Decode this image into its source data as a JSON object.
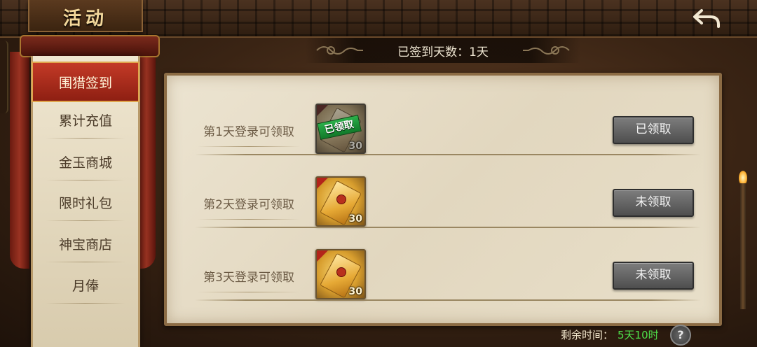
{
  "header": {
    "title": "活动",
    "back_icon": "back-arrow-icon"
  },
  "signed_banner": {
    "text": "已签到天数：1天"
  },
  "sidebar": {
    "items": [
      {
        "label": "围猎签到",
        "active": true
      },
      {
        "label": "累计充值",
        "active": false
      },
      {
        "label": "金玉商城",
        "active": false
      },
      {
        "label": "限时礼包",
        "active": false
      },
      {
        "label": "神宝商店",
        "active": false
      },
      {
        "label": "月俸",
        "active": false
      }
    ]
  },
  "rewards": [
    {
      "label": "第1天登录可领取",
      "item_count": "30",
      "stamp": "已领取",
      "button": "已领取",
      "claimed": true
    },
    {
      "label": "第2天登录可领取",
      "item_count": "30",
      "stamp": "",
      "button": "未领取",
      "claimed": false
    },
    {
      "label": "第3天登录可领取",
      "item_count": "30",
      "stamp": "",
      "button": "未领取",
      "claimed": false
    }
  ],
  "footer": {
    "remaining_label": "剩余时间：",
    "remaining_value": "5天10时",
    "help": "?"
  },
  "colors": {
    "active_tab": "#c33a27",
    "timer_green": "#4ee04a",
    "button_gray": "#6a6a6a",
    "stamp_green": "#2bb04a"
  }
}
